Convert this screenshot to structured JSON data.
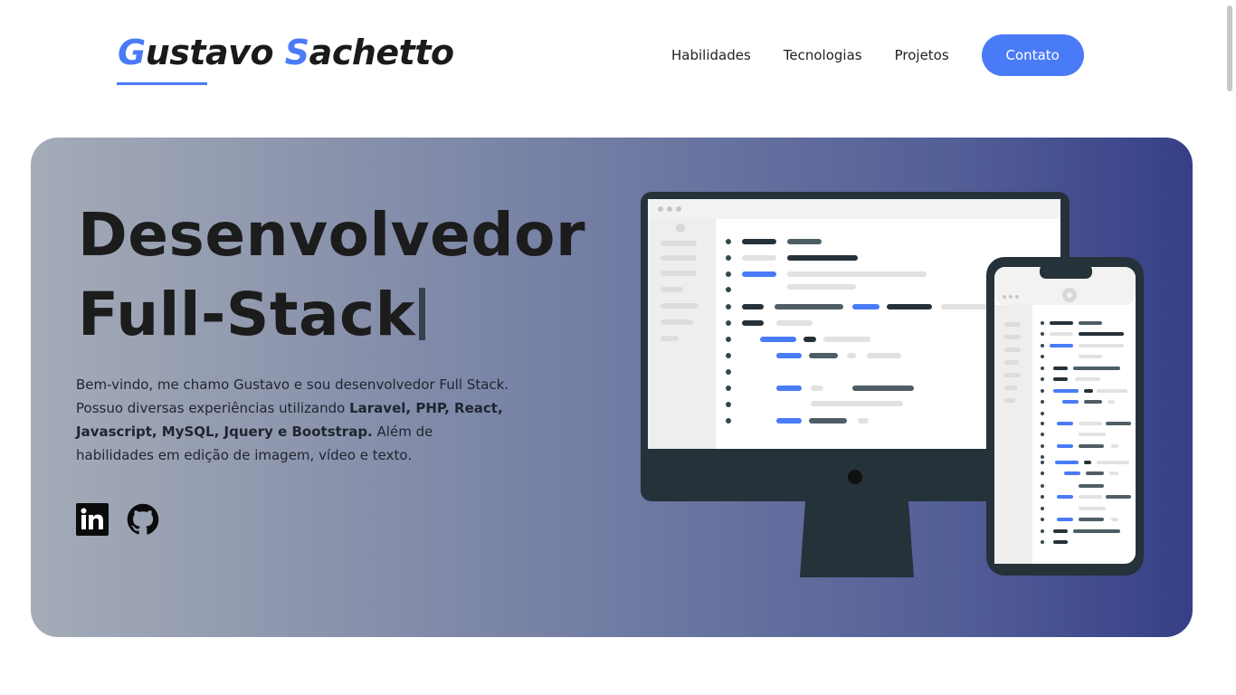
{
  "header": {
    "logo": {
      "first_initial": "G",
      "first_rest": "ustavo ",
      "last_initial": "S",
      "last_rest": "achetto"
    },
    "nav": [
      {
        "label": "Habilidades"
      },
      {
        "label": "Tecnologias"
      },
      {
        "label": "Projetos"
      }
    ],
    "cta_label": "Contato"
  },
  "hero": {
    "title_line1": "Desenvolvedor",
    "title_line2": "Full-Stack",
    "description": {
      "part1": "Bem-vindo, me chamo Gustavo e sou desenvolvedor Full Stack. Possuo diversas experiências utilizando ",
      "bold": "Laravel, PHP, React, Javascript, MySQL, Jquery e Bootstrap.",
      "part2": " Além de habilidades em edição de imagem, vídeo e texto."
    },
    "socials": [
      {
        "icon": "linkedin-icon"
      },
      {
        "icon": "github-icon"
      }
    ]
  },
  "colors": {
    "accent": "#4a7bf7",
    "hero_gradient_start": "#a4acb8",
    "hero_gradient_end": "#363f86",
    "device_frame": "#26323a"
  }
}
